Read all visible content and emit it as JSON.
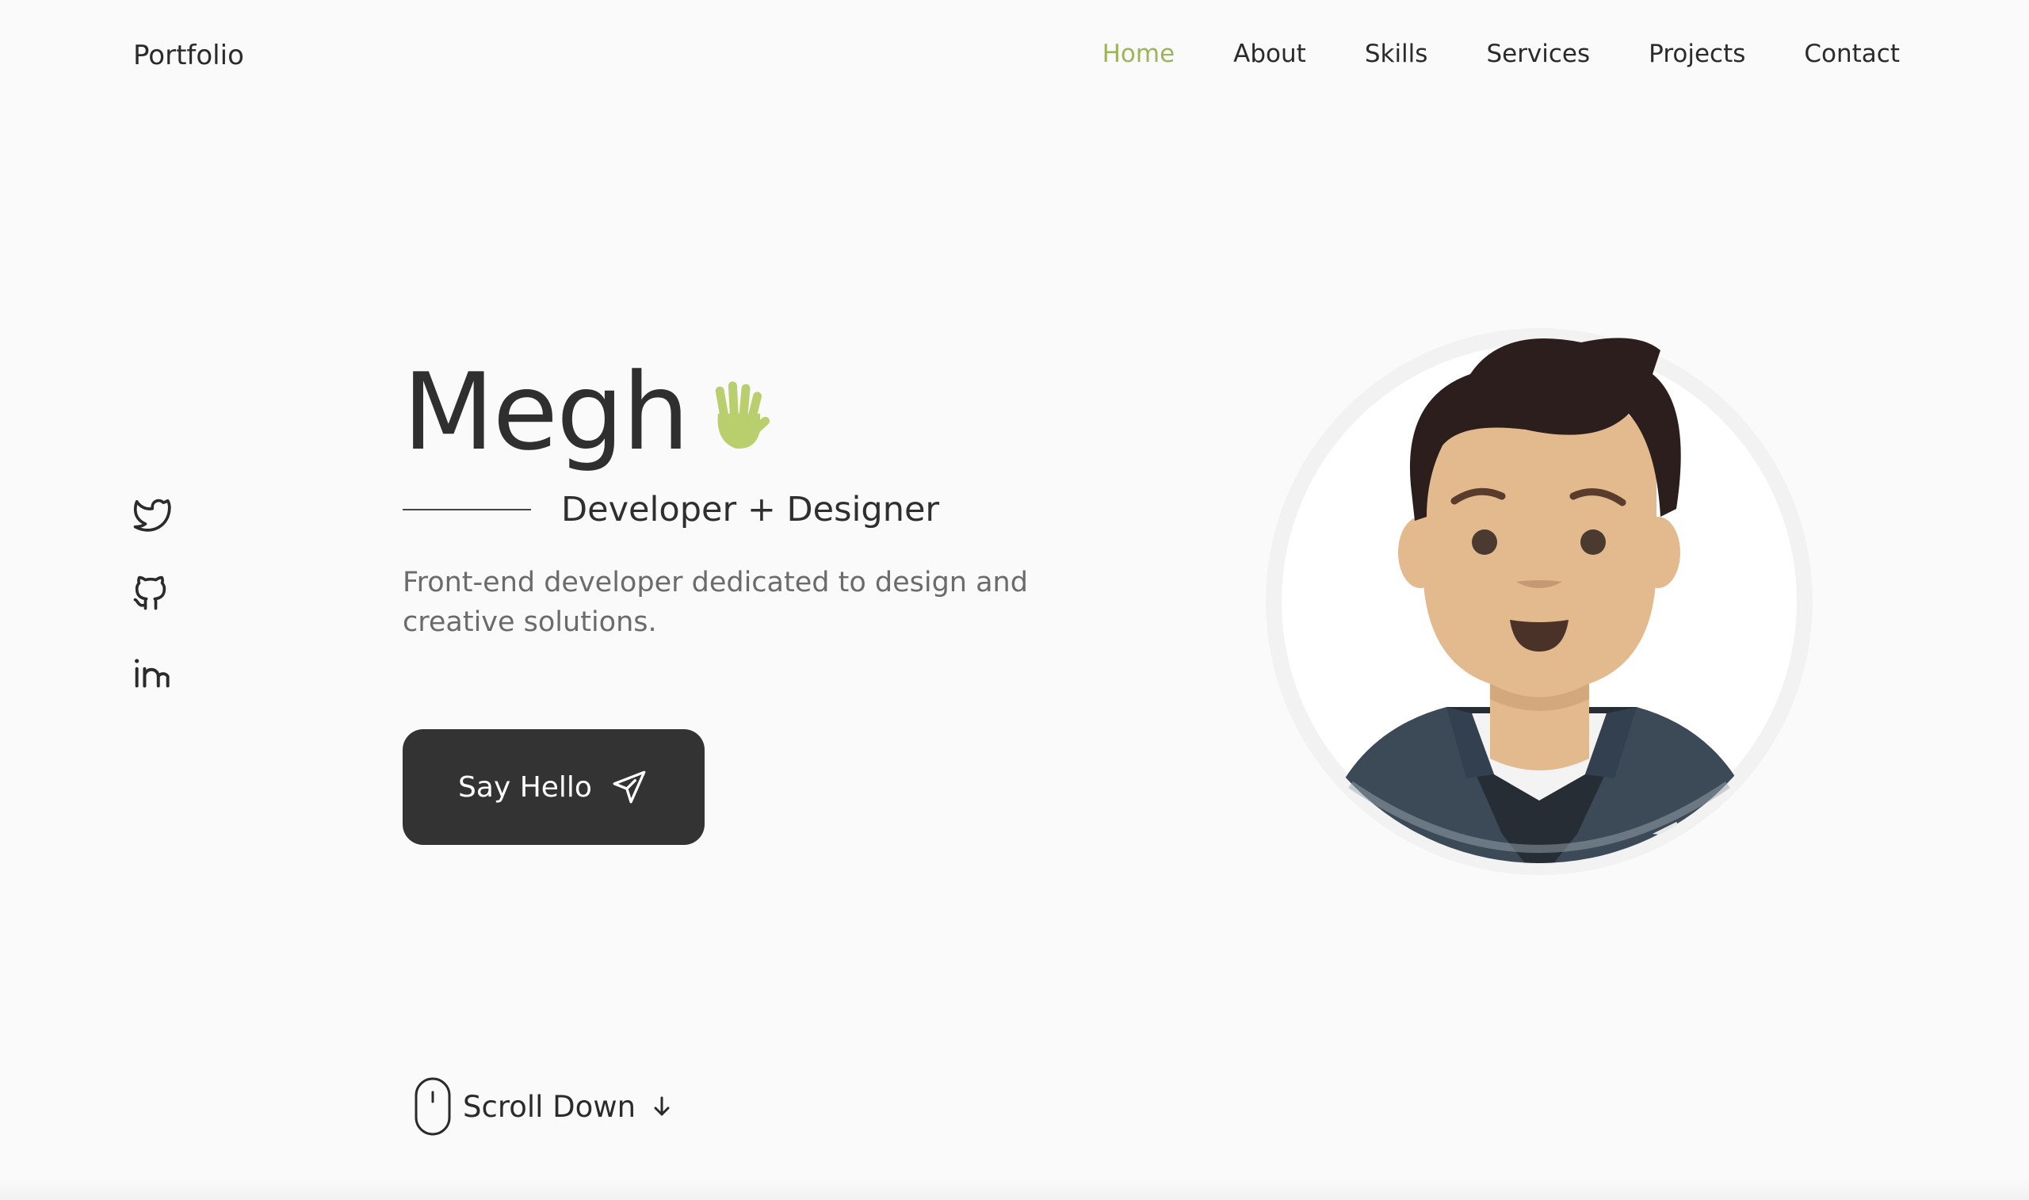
{
  "header": {
    "logo": "Portfolio",
    "nav": [
      {
        "label": "Home",
        "active": true
      },
      {
        "label": "About",
        "active": false
      },
      {
        "label": "Skills",
        "active": false
      },
      {
        "label": "Services",
        "active": false
      },
      {
        "label": "Projects",
        "active": false
      },
      {
        "label": "Contact",
        "active": false
      }
    ]
  },
  "socials": [
    {
      "icon": "twitter-icon"
    },
    {
      "icon": "github-icon"
    },
    {
      "icon": "linkedin-icon"
    }
  ],
  "hero": {
    "name": "Megh",
    "wave_icon": "waving-hand-icon",
    "subtitle": "Developer + Designer",
    "description": "Front-end developer dedicated to design and creative solutions.",
    "cta_label": "Say Hello",
    "cta_icon": "send-icon"
  },
  "scroll": {
    "label": "Scroll Down",
    "mouse_icon": "mouse-icon",
    "arrow_icon": "arrow-down-icon"
  },
  "colors": {
    "accent": "#9db55a",
    "text": "#2b2b2b",
    "muted": "#6b6b6b",
    "button_bg": "#333333",
    "background": "#fafafa"
  }
}
